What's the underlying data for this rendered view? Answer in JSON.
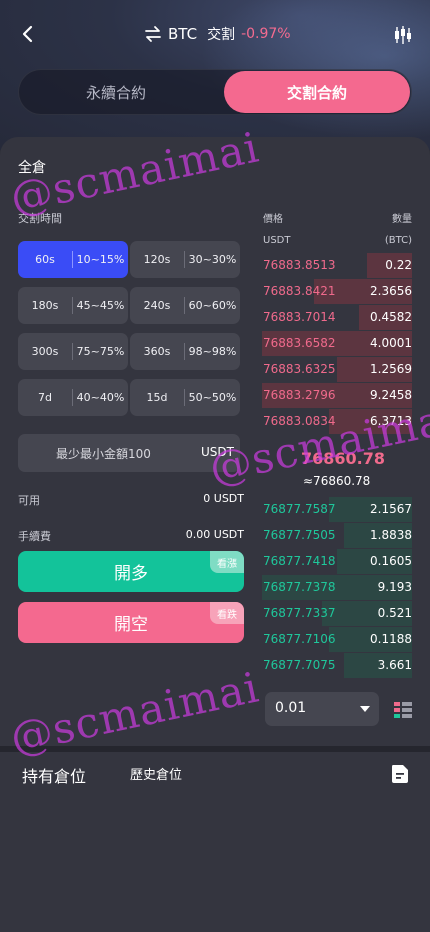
{
  "header": {
    "symbol": "BTC",
    "type": "交割",
    "change": "-0.97%"
  },
  "tabs": {
    "perpetual": "永續合約",
    "delivery": "交割合約"
  },
  "margin_mode": "全倉",
  "duration_label": "交割時間",
  "durations": [
    {
      "time": "60s",
      "range": "10~15%"
    },
    {
      "time": "120s",
      "range": "30~30%"
    },
    {
      "time": "180s",
      "range": "45~45%"
    },
    {
      "time": "240s",
      "range": "60~60%"
    },
    {
      "time": "300s",
      "range": "75~75%"
    },
    {
      "time": "360s",
      "range": "98~98%"
    },
    {
      "time": "7d",
      "range": "40~40%"
    },
    {
      "time": "15d",
      "range": "50~50%"
    }
  ],
  "amount": {
    "placeholder": "最少最小金額100",
    "unit": "USDT"
  },
  "available": {
    "label": "可用",
    "value": "0 USDT"
  },
  "fee": {
    "label": "手續費",
    "value": "0.00 USDT"
  },
  "buttons": {
    "long": "開多",
    "long_tag": "看漲",
    "short": "開空",
    "short_tag": "看跌"
  },
  "orderbook": {
    "price_label": "價格",
    "qty_label": "數量",
    "price_unit": "USDT",
    "qty_unit": "(BTC)",
    "asks": [
      {
        "price": "76883.8513",
        "qty": "0.22",
        "depth": 0.3
      },
      {
        "price": "76883.8421",
        "qty": "2.3656",
        "depth": 0.65
      },
      {
        "price": "76883.7014",
        "qty": "0.4582",
        "depth": 0.35
      },
      {
        "price": "76883.6582",
        "qty": "4.0001",
        "depth": 1.0
      },
      {
        "price": "76883.6325",
        "qty": "1.2569",
        "depth": 0.5
      },
      {
        "price": "76883.2796",
        "qty": "9.2458",
        "depth": 1.0
      },
      {
        "price": "76883.0834",
        "qty": "6.3713",
        "depth": 0.55
      }
    ],
    "mid_price": "76860.78",
    "mid_sub": "≈76860.78",
    "bids": [
      {
        "price": "76877.7587",
        "qty": "2.1567",
        "depth": 0.55
      },
      {
        "price": "76877.7505",
        "qty": "1.8838",
        "depth": 0.45
      },
      {
        "price": "76877.7418",
        "qty": "0.1605",
        "depth": 0.5
      },
      {
        "price": "76877.7378",
        "qty": "9.193",
        "depth": 1.0
      },
      {
        "price": "76877.7337",
        "qty": "0.521",
        "depth": 0.6
      },
      {
        "price": "76877.7106",
        "qty": "0.1188",
        "depth": 0.55
      },
      {
        "price": "76877.7075",
        "qty": "3.661",
        "depth": 0.45
      }
    ],
    "depth_value": "0.01"
  },
  "positions": {
    "current": "持有倉位",
    "history": "歷史倉位"
  },
  "watermark": "@scmaimai",
  "colors": {
    "accent_pink": "#f4698f",
    "accent_green": "#13c39a",
    "accent_blue": "#3a4cf6"
  }
}
